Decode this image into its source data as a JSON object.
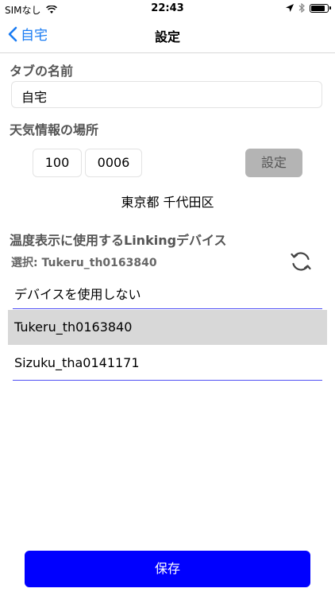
{
  "status_bar": {
    "carrier": "SIMなし",
    "time": "22:43",
    "battery_level": 0.9,
    "icons": [
      "wifi-icon",
      "location-arrow-icon",
      "bluetooth-icon",
      "battery-icon"
    ]
  },
  "nav": {
    "back_label": "自宅",
    "title": "設定",
    "accent_color": "#1a7cf3"
  },
  "tab_name": {
    "heading": "タブの名前",
    "value": "自宅"
  },
  "weather": {
    "heading": "天気情報の場所",
    "postal_first": "100",
    "postal_second": "0006",
    "set_button": "設定",
    "location": "東京都 千代田区"
  },
  "device": {
    "heading": "温度表示に使用するLinkingデバイス",
    "selected_label": "選択: Tukeru_th0163840",
    "options": [
      {
        "label": "デバイスを使用しない",
        "selected": false
      },
      {
        "label": "Tukeru_th0163840",
        "selected": true
      },
      {
        "label": "Sizuku_tha0141171",
        "selected": false
      }
    ]
  },
  "footer": {
    "save_label": "保存",
    "save_color": "#0000ff"
  }
}
